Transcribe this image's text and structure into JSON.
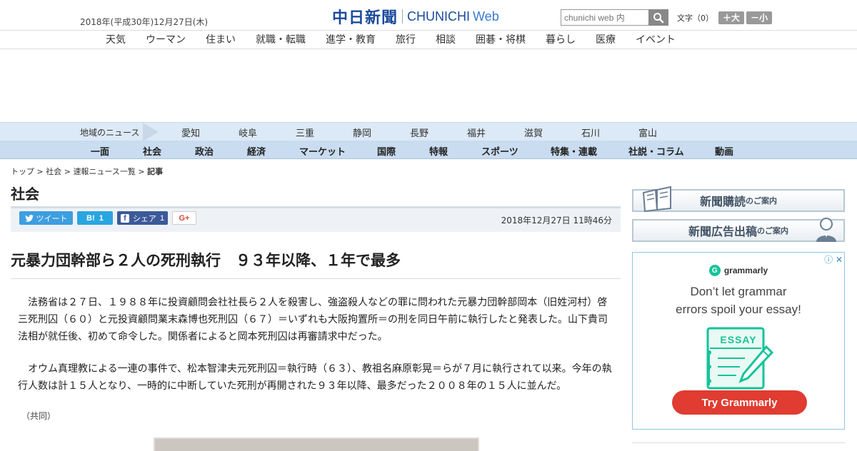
{
  "header": {
    "date": "2018年(平成30年)12月27日(木)",
    "logo_jp": "中日新聞",
    "logo_en": "CHUNICHI",
    "logo_en2": "Web",
    "search_placeholder": "chunichi web 内",
    "font_label": "文字（0）",
    "font_larger": "＋大",
    "font_smaller": "－小"
  },
  "top_nav": [
    "天気",
    "ウーマン",
    "住まい",
    "就職・転職",
    "進学・教育",
    "旅行",
    "相談",
    "囲碁・将棋",
    "暮らし",
    "医療",
    "イベント"
  ],
  "region_nav": {
    "label": "地域のニュース",
    "items": [
      "愛知",
      "岐阜",
      "三重",
      "静岡",
      "長野",
      "福井",
      "滋賀",
      "石川",
      "富山"
    ]
  },
  "category_nav": [
    "一面",
    "社会",
    "政治",
    "経済",
    "マーケット",
    "国際",
    "特報",
    "スポーツ",
    "特集・連載",
    "社説・コラム",
    "動画"
  ],
  "breadcrumb": {
    "items": [
      "トップ",
      "社会",
      "速報ニュース一覧"
    ],
    "current": "記事",
    "sep": " > "
  },
  "section_title": "社会",
  "share": {
    "tweet": "ツイート",
    "hatena_count": "1",
    "facebook": "シェア",
    "facebook_count": "1",
    "gplus": "G+",
    "published": "2018年12月27日 11時46分"
  },
  "article": {
    "headline": "元暴力団幹部ら２人の死刑執行　９３年以降、１年で最多",
    "paragraphs": [
      "　法務省は２７日、１９８８年に投資顧問会社社長ら２人を殺害し、強盗殺人などの罪に問われた元暴力団幹部岡本（旧姓河村）啓三死刑囚（６０）と元投資顧問業末森博也死刑囚（６７）＝いずれも大阪拘置所＝の刑を同日午前に執行したと発表した。山下貴司法相が就任後、初めて命令した。関係者によると岡本死刑囚は再審請求中だった。",
      "　オウム真理教による一連の事件で、松本智津夫元死刑囚＝執行時（６３）、教祖名麻原彰晃＝らが７月に執行されて以来。今年の執行人数は計１５人となり、一時的に中断していた死刑が再開された９３年以降、最多だった２００８年の１５人に並んだ。"
    ],
    "credit": "（共同）"
  },
  "sidebar": {
    "subscribe": {
      "big": "新聞購読",
      "small": "のご案内"
    },
    "advertise": {
      "big": "新聞広告出稿",
      "small": "のご案内"
    },
    "ad": {
      "brand": "grammarly",
      "line1": "Don’t let grammar",
      "line2": "errors spoil your essay!",
      "essay_label": "ESSAY",
      "cta": "Try Grammarly"
    }
  },
  "colors": {
    "logo_blue": "#1b4a9c",
    "region_bar": "#dce9f6",
    "category_bar": "#c9dcf0",
    "tweet": "#3d9ee0",
    "hatena": "#29a6e0",
    "facebook": "#3c5a99",
    "cta_red": "#e03c31",
    "grammarly_green": "#15c39a"
  }
}
